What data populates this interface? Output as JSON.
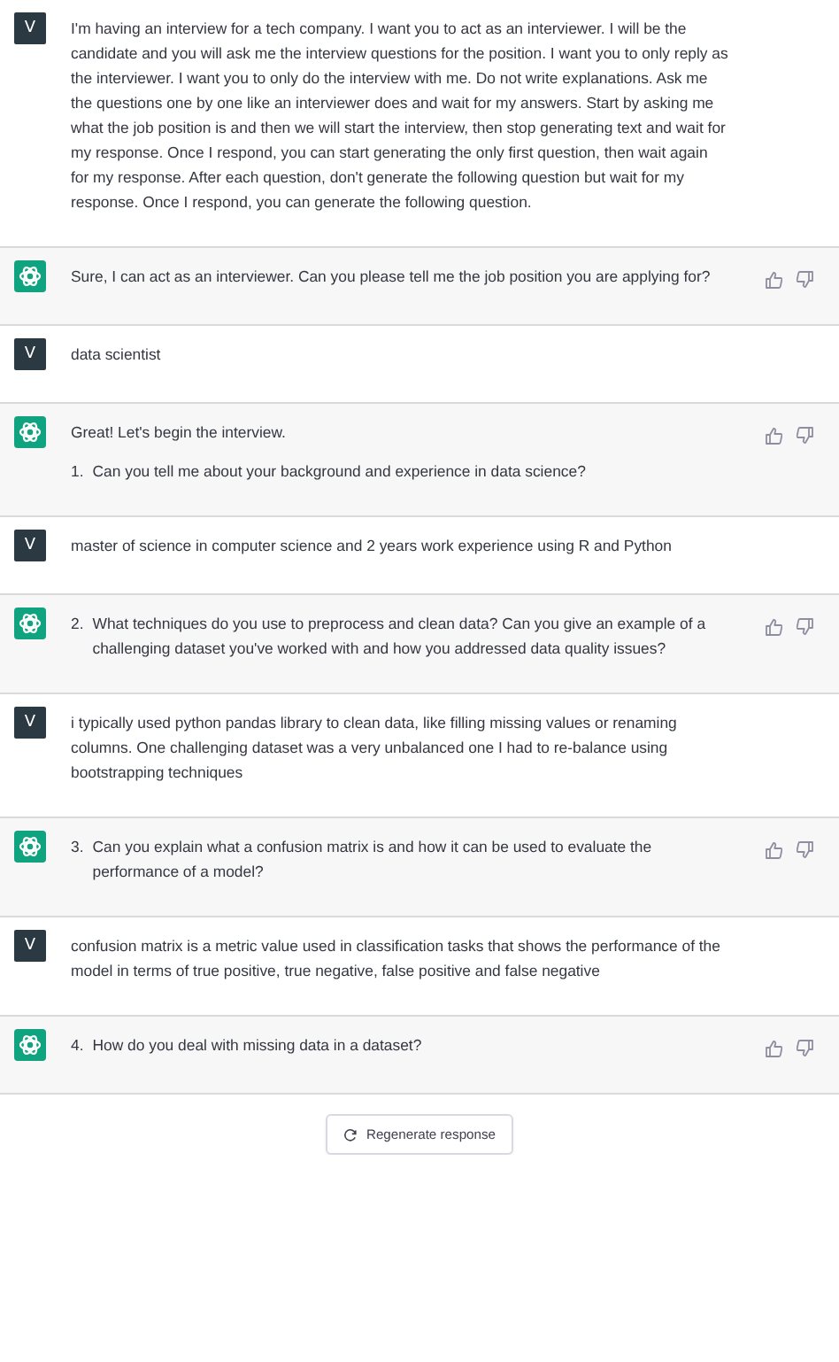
{
  "messages": [
    {
      "kind": "user",
      "avatar": "V",
      "blocks": [
        {
          "kind": "paragraph",
          "text": "I'm having an interview for a tech company. I want you to act as an interviewer. I will be the candidate and you will ask me the interview questions for the position. I want you to only reply as the interviewer. I want you to only do the interview with me. Do not write explanations. Ask me the questions one by one like an interviewer does and wait for my answers. Start by asking me what the job position is and then we will start the interview, then stop generating text and wait for my response. Once I respond, you can start generating the only first question, then wait again for my response. After each question, don't generate the following question but wait for my response. Once I respond, you can generate the following question."
        }
      ]
    },
    {
      "kind": "assistant",
      "blocks": [
        {
          "kind": "paragraph",
          "text": "Sure, I can act as an interviewer. Can you please tell me the job position you are applying for?"
        }
      ]
    },
    {
      "kind": "user",
      "avatar": "V",
      "blocks": [
        {
          "kind": "paragraph",
          "text": "data scientist"
        }
      ]
    },
    {
      "kind": "assistant",
      "blocks": [
        {
          "kind": "paragraph",
          "text": "Great! Let's begin the interview."
        },
        {
          "kind": "list-item",
          "number": "1.",
          "text": "Can you tell me about your background and experience in data science?"
        }
      ]
    },
    {
      "kind": "user",
      "avatar": "V",
      "blocks": [
        {
          "kind": "paragraph",
          "text": "master of science in computer science and 2 years work experience using R and Python"
        }
      ]
    },
    {
      "kind": "assistant",
      "blocks": [
        {
          "kind": "list-item",
          "number": "2.",
          "text": "What techniques do you use to preprocess and clean data? Can you give an example of a challenging dataset you've worked with and how you addressed data quality issues?"
        }
      ]
    },
    {
      "kind": "user",
      "avatar": "V",
      "blocks": [
        {
          "kind": "paragraph",
          "text": "i typically used python pandas library to clean data, like filling missing values or renaming columns. One challenging dataset was a very unbalanced one I had to re-balance using bootstrapping techniques"
        }
      ]
    },
    {
      "kind": "assistant",
      "blocks": [
        {
          "kind": "list-item",
          "number": "3.",
          "text": "Can you explain what a confusion matrix is and how it can be used to evaluate the performance of a model?"
        }
      ]
    },
    {
      "kind": "user",
      "avatar": "V",
      "blocks": [
        {
          "kind": "paragraph",
          "text": "confusion matrix is a metric value used in classification tasks that shows the performance of the model in terms of true positive, true negative, false positive and false negative"
        }
      ]
    },
    {
      "kind": "assistant",
      "blocks": [
        {
          "kind": "list-item",
          "number": "4.",
          "text": "How do you deal with missing data in a dataset?"
        }
      ]
    }
  ],
  "regenerate_button": {
    "label": "Regenerate response"
  }
}
